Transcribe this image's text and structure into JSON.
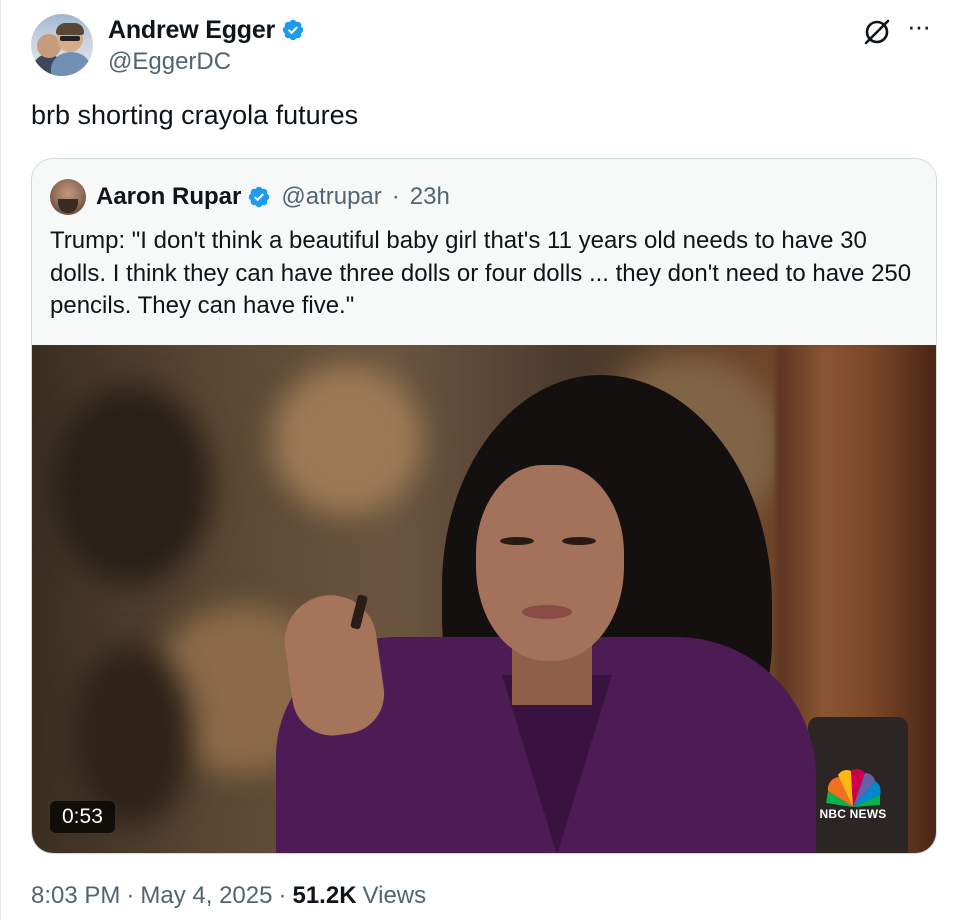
{
  "author": {
    "display_name": "Andrew Egger",
    "handle": "@EggerDC",
    "verified": true,
    "avatar_icon": "avatar-photo"
  },
  "tweet": {
    "text": "brb shorting crayola futures"
  },
  "header_icons": {
    "grok": "grok-slash-icon",
    "more": "···"
  },
  "quote": {
    "display_name": "Aaron Rupar",
    "handle": "@atrupar",
    "separator": "·",
    "time": "23h",
    "verified": true,
    "text": "Trump: \"I don't think a beautiful baby girl that's 11 years old needs to have 30 dolls. I think they can have three dolls or four dolls ... they don't need to have 250 pencils. They can have five.\"",
    "video": {
      "duration": "0:53",
      "network_logo": "NBC NEWS"
    }
  },
  "meta": {
    "time": "8:03 PM",
    "sep1": "·",
    "date": "May 4, 2025",
    "sep2": "·",
    "views_count": "51.2K",
    "views_label": "Views"
  },
  "colors": {
    "verified_blue": "#1d9bf0",
    "secondary_text": "#536471",
    "primary_text": "#0f1419",
    "quote_bg": "#f7f9f9",
    "border": "#cfd9de"
  }
}
